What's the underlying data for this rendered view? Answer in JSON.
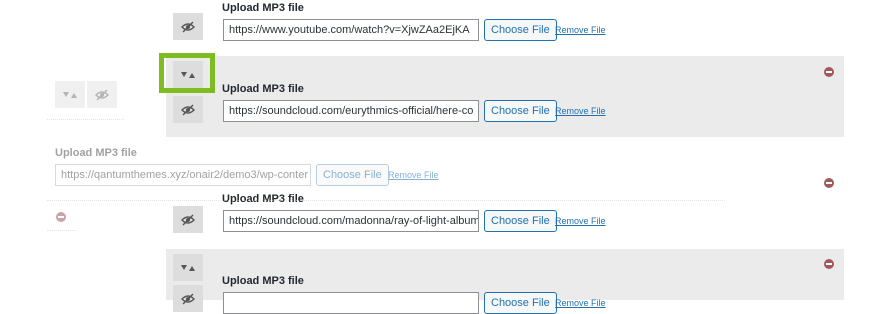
{
  "label": "Upload MP3 file",
  "choose_label": "Choose File",
  "remove_label": "Remove File",
  "rows": [
    {
      "url": "https://www.youtube.com/watch?v=XjwZAa2EjKA"
    },
    {
      "url": "https://soundcloud.com/eurythmics-official/here-co"
    },
    {
      "url": "https://soundcloud.com/madonna/ray-of-light-album"
    },
    {
      "url": ""
    }
  ],
  "dragged": {
    "url": "https://qantumthemes.xyz/onair2/demo3/wp-conter"
  },
  "colors": {
    "highlight": "#7dbd22",
    "link": "#2271b1",
    "remove_icon": "#a05a5a"
  },
  "icons": [
    "sort-arrows-icon",
    "hidden-eye-icon",
    "remove-circle-icon"
  ]
}
